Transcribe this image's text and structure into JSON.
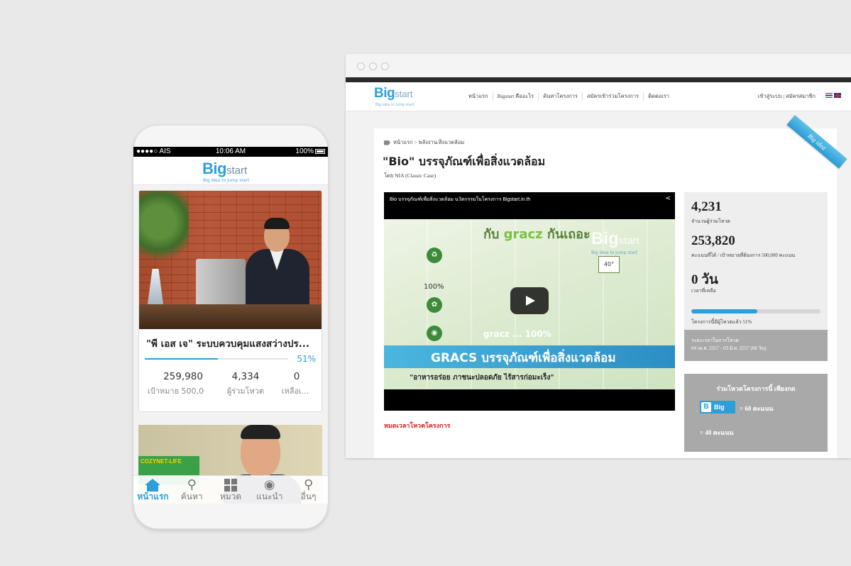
{
  "desktop": {
    "nav": [
      "หน้าแรก",
      "Bigstart คืออะไร",
      "ค้นหาโครงการ",
      "สมัครเข้าร่วมโครงการ",
      "ติดต่อเรา"
    ],
    "login": "เข้าสู่ระบบ | สมัครสมาชิก",
    "logo": {
      "big": "Big",
      "start": "start",
      "tagline": "Big idea to jump start"
    },
    "ribbon": "Big idea",
    "breadcrumb": "หน้าแรก > พลังงาน/สิ่งแวดล้อม",
    "title": "\"Bio\" บรรจุภัณฑ์เพื่อสิ่งแวดล้อม",
    "byline": "โดย  NIA (Classic Case)",
    "video": {
      "title": "Bio บรรจุภัณฑ์เพื่อสิ่งแวดล้อม นวัตกรรมในโครงการ Bigstart.in.th",
      "headline_pre": "กับ ",
      "headline_brand": "gracz",
      "headline_post": " กันเถอะ",
      "pct_left": "100%",
      "center_text": "gracz ... 100%",
      "banner": "GRACS  บรรจุภัณฑ์เพื่อสิ่งแวดล้อม",
      "slogan": "\"อาหารอร่อย ภาชนะปลอดภัย ไร้สารก่อมะเร็ง\"",
      "badge": "40°",
      "watermark_big": "Big",
      "watermark_start": "start",
      "watermark_sub": "Big idea to jump start"
    },
    "expired": "หมดเวลาโหวตโครงการ",
    "stats": {
      "voters": "4,231",
      "voters_label": "จำนวนผู้ร่วมโหวต",
      "score": "253,820",
      "score_label": "คะแนนที่ได้ / เป้าหมายที่ต้องการ 500,000 คะแนน",
      "days": "0 วัน",
      "days_label": "เวลาที่เหลือ",
      "progress_fraction": 0.51,
      "progress_label": "โครงการนี้มีผู้โหวตแล้ว 51%"
    },
    "period": {
      "label": "ระยะเวลาในการโหวต",
      "range": "04 เม.ย. 2557 - 03 มิ.ย. 2557 (60 วัน)"
    },
    "vote": {
      "title": "ร่วมโหวตโครงการนี้ เพียงกด",
      "button_b": "B",
      "button_label": "Big",
      "score1": "= 60 คะแนน",
      "score2": "= 40 คะแนน"
    }
  },
  "phone": {
    "status": {
      "carrier": "●●●●○ AIS",
      "time": "10:06 AM",
      "battery": "100%"
    },
    "logo": {
      "big": "Big",
      "start": "start",
      "tagline": "Big idea to jump start"
    },
    "card1": {
      "title": "\"พี เอส เจ\" ระบบควบคุมแสงสว่างปร...",
      "progress_fraction": 0.51,
      "progress_label": "51%",
      "stats": [
        {
          "value": "259,980",
          "label": "เป้าหมาย 500,000..."
        },
        {
          "value": "4,334",
          "label": "ผู้ร่วมโหวต"
        },
        {
          "value": "0",
          "label": "เหลือเ..."
        }
      ]
    },
    "card2": {
      "sign": "COZYNET-LIFE"
    },
    "tabs": [
      {
        "label": "หน้าแรก",
        "icon": "home-icon",
        "active": true
      },
      {
        "label": "ค้นหา",
        "icon": "search-icon"
      },
      {
        "label": "หมวด",
        "icon": "grid-icon"
      },
      {
        "label": "แนะนำ",
        "icon": "eye-icon"
      },
      {
        "label": "อื่นๆ",
        "icon": "location-pin-icon"
      }
    ]
  },
  "colors": {
    "brand_blue": "#2d9fd8",
    "expired_red": "#e31b1b",
    "panel_gray": "#a9a9a9"
  }
}
